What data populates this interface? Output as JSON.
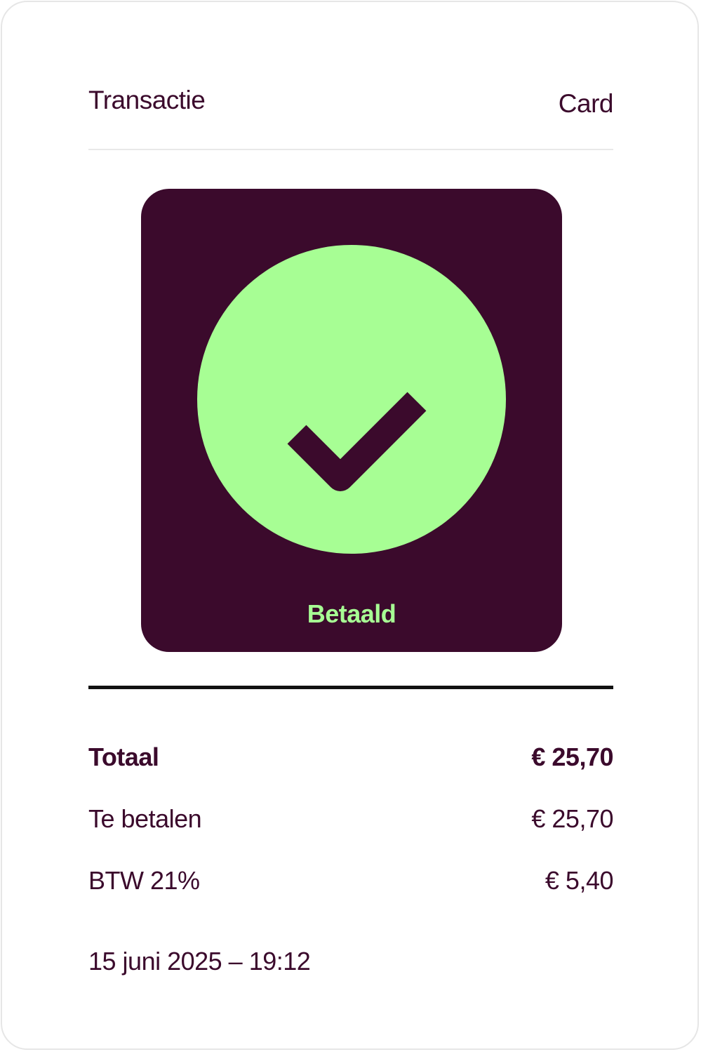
{
  "header": {
    "title": "Transactie",
    "method": "Card"
  },
  "status": {
    "icon": "checkmark-icon",
    "label": "Betaald",
    "colors": {
      "panel": "#3b0a2c",
      "accent": "#a7fe94"
    }
  },
  "summary": {
    "total_label": "Totaal",
    "total_value": "€ 25,70",
    "due_label": "Te betalen",
    "due_value": "€ 25,70",
    "vat_label": "BTW 21%",
    "vat_value": "€ 5,40"
  },
  "timestamp": "15 juni 2025 – 19:12"
}
